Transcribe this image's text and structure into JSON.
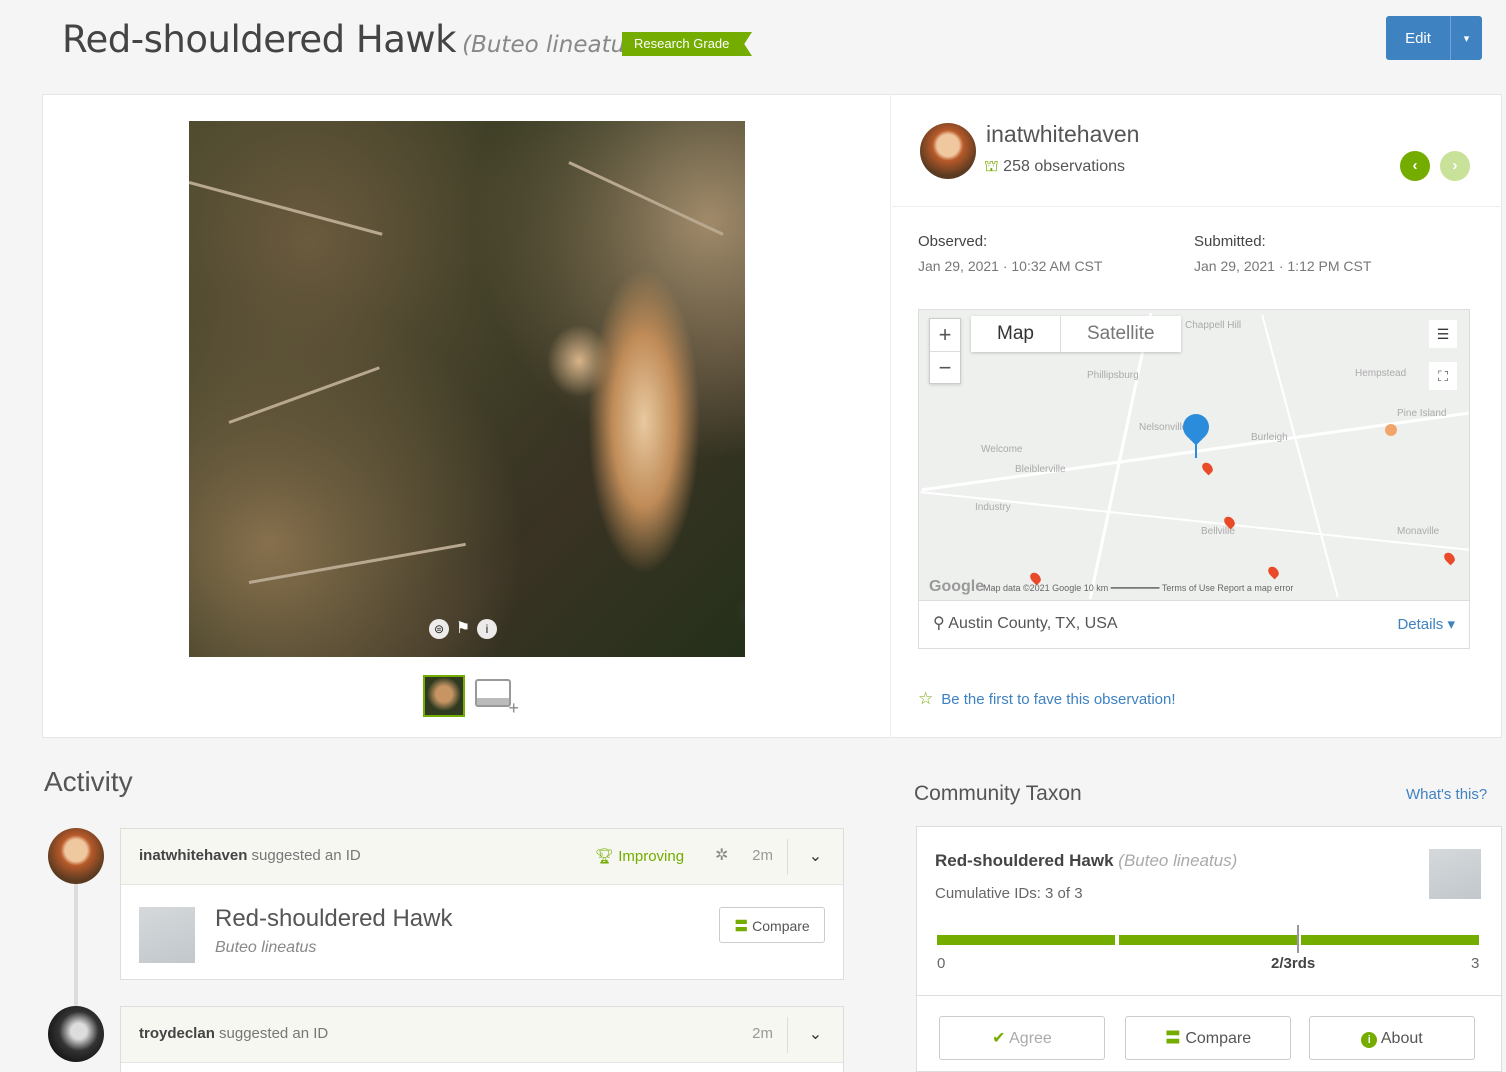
{
  "header": {
    "common_name": "Red-shouldered Hawk",
    "scientific_name": "(Buteo lineatus)",
    "quality_badge": "Research Grade",
    "edit_label": "Edit",
    "edit_caret": "▾"
  },
  "photo": {
    "controls": [
      "⊜",
      "⚑",
      "i"
    ],
    "add_photo_plus": "+"
  },
  "user": {
    "name": "inatwhitehaven",
    "observations": "258 observations",
    "prev": "‹",
    "next": "›"
  },
  "dates": {
    "observed_label": "Observed:",
    "observed_value": "Jan 29, 2021 · 10:32 AM CST",
    "submitted_label": "Submitted:",
    "submitted_value": "Jan 29, 2021 · 1:12 PM CST"
  },
  "map": {
    "zoom_in": "+",
    "zoom_out": "−",
    "type_map": "Map",
    "type_satellite": "Satellite",
    "google": "Google",
    "attribution": "Map data ©2021 Google   10 km ━━━━━━━━━   Terms of Use   Report a map error",
    "place_labels": [
      "Chappell Hill",
      "Phillipsburg",
      "Hempstead",
      "Pine Island",
      "Burleigh",
      "Welcome",
      "Bleiblerville",
      "Industry",
      "Bellville",
      "Monaville",
      "Nelsonville"
    ]
  },
  "place": {
    "name": "Austin County, TX, USA",
    "details": "Details ▾"
  },
  "fave": {
    "text": "Be the first to fave this observation!"
  },
  "activity": {
    "title": "Activity",
    "items": [
      {
        "user": "inatwhitehaven",
        "action": " suggested an ID",
        "status": "Improving",
        "time": "2m",
        "taxon_common": "Red-shouldered Hawk",
        "taxon_sci": "Buteo lineatus",
        "compare": "Compare"
      },
      {
        "user": "troydeclan",
        "action": " suggested an ID",
        "time": "2m"
      }
    ]
  },
  "community_taxon": {
    "title": "Community Taxon",
    "whats_this": "What's this?",
    "common_name": "Red-shouldered Hawk",
    "scientific_name": "(Buteo lineatus)",
    "cumulative": "Cumulative IDs: 3 of 3",
    "agreement_fraction": 1.0,
    "scale_min": "0",
    "scale_mid": "2/3rds",
    "scale_max": "3",
    "agree": "Agree",
    "compare": "Compare",
    "about": "About"
  },
  "colors": {
    "accent_green": "#74ac00",
    "link_blue": "#3f82c1",
    "pin_blue": "#2c8cdc"
  }
}
